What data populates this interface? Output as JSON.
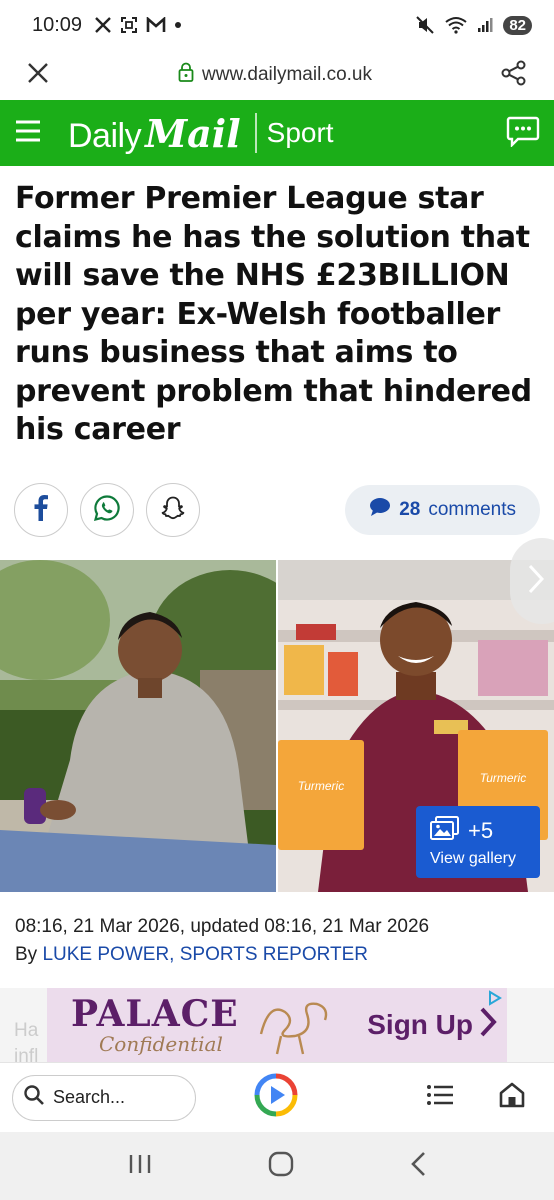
{
  "status_bar": {
    "time": "10:09",
    "battery": "82",
    "icons": [
      "x-icon",
      "screenshot-icon",
      "gmail-icon",
      "dot-icon",
      "mute-icon",
      "wifi-icon",
      "signal-icon"
    ]
  },
  "url_bar": {
    "url": "www.dailymail.co.uk"
  },
  "header": {
    "logo_daily": "Daily",
    "logo_mail": "Mail",
    "section": "Sport",
    "brand_color": "#1bae18"
  },
  "article": {
    "headline": "Former Premier League star claims he has the solution that will save the NHS £23BILLION per year: Ex-Welsh footballer runs business that aims to prevent problem that hindered his career",
    "comments_count": "28",
    "comments_label": "comments",
    "gallery_count": "+5",
    "gallery_label": "View gallery",
    "dates": "08:16, 21 Mar 2026, updated 08:16, 21 Mar 2026",
    "by_prefix": "By",
    "author": "LUKE POWER, SPORTS REPORTER",
    "truncated_text": "Ha\ninfl"
  },
  "ad": {
    "brand": "PALACE",
    "tagline": "Confidential",
    "cta": "Sign Up",
    "product_label": "Turmeric"
  },
  "bottom_bar": {
    "search_placeholder": "Search..."
  }
}
